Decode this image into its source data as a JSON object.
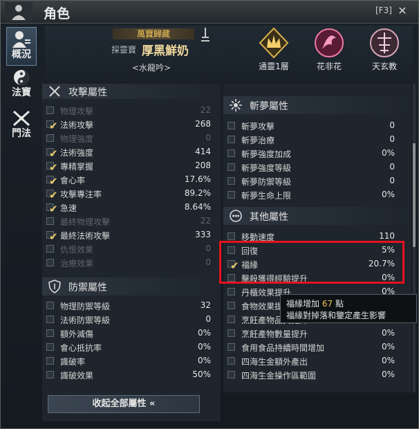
{
  "window": {
    "title": "角色",
    "hotkey": "[F3]"
  },
  "sidebar": [
    {
      "label": "概況",
      "icon": "character-overview-icon",
      "active": true
    },
    {
      "label": "法寶",
      "icon": "yin-yang-icon",
      "active": false
    },
    {
      "label": "門法",
      "icon": "sword-cross-icon",
      "active": false
    }
  ],
  "header": {
    "title_banner": "萬寶歸藏",
    "name_prefix": "探靈寶",
    "character_name": "厚黑鮮奶",
    "guild": "<水龍吟>",
    "badges": [
      {
        "label": "通靈1層",
        "icon": "crown-icon"
      },
      {
        "label": "花非花",
        "icon": "phoenix-icon"
      },
      {
        "label": "天玄教",
        "icon": "sect-emblem-icon"
      }
    ]
  },
  "attack_section": {
    "title": "攻擊屬性",
    "rows": [
      {
        "label": "物理攻擊",
        "value": "22",
        "checked": false,
        "dim": true
      },
      {
        "label": "法術攻擊",
        "value": "268",
        "checked": true,
        "dim": false
      },
      {
        "label": "物理強度",
        "value": "0",
        "checked": false,
        "dim": true
      },
      {
        "label": "法術強度",
        "value": "414",
        "checked": true,
        "dim": false
      },
      {
        "label": "專精掌握",
        "value": "208",
        "checked": true,
        "dim": false
      },
      {
        "label": "會心率",
        "value": "17.6%",
        "checked": true,
        "dim": false
      },
      {
        "label": "攻擊專注率",
        "value": "89.2%",
        "checked": true,
        "dim": false
      },
      {
        "label": "急速",
        "value": "8.64%",
        "checked": true,
        "dim": false
      },
      {
        "label": "最終物理攻擊",
        "value": "22",
        "checked": false,
        "dim": true
      },
      {
        "label": "最終法術攻擊",
        "value": "333",
        "checked": true,
        "dim": false
      },
      {
        "label": "仇恨效果",
        "value": "0",
        "checked": false,
        "dim": true
      },
      {
        "label": "治療效果",
        "value": "0",
        "checked": false,
        "dim": true
      }
    ]
  },
  "defense_section": {
    "title": "防禦屬性",
    "rows": [
      {
        "label": "物理防禦等級",
        "value": "32",
        "checked": false,
        "dim": false
      },
      {
        "label": "法術防禦等級",
        "value": "0",
        "checked": false,
        "dim": false
      },
      {
        "label": "額外減傷",
        "value": "0%",
        "checked": false,
        "dim": false
      },
      {
        "label": "會心抵抗率",
        "value": "0%",
        "checked": false,
        "dim": false
      },
      {
        "label": "識破率",
        "value": "0%",
        "checked": false,
        "dim": false
      },
      {
        "label": "識破效果",
        "value": "50%",
        "checked": false,
        "dim": false
      }
    ]
  },
  "dream_section": {
    "title": "斬夢屬性",
    "rows": [
      {
        "label": "斬夢攻擊",
        "value": "0",
        "checked": false,
        "dim": false
      },
      {
        "label": "斬夢治療",
        "value": "0",
        "checked": false,
        "dim": false
      },
      {
        "label": "斬夢強度加成",
        "value": "0%",
        "checked": false,
        "dim": false
      },
      {
        "label": "斬夢強度等級",
        "value": "0",
        "checked": false,
        "dim": false
      },
      {
        "label": "斬夢防禦等級",
        "value": "0",
        "checked": false,
        "dim": false
      },
      {
        "label": "斬夢生命上限",
        "value": "0%",
        "checked": false,
        "dim": false
      }
    ]
  },
  "other_section": {
    "title": "其他屬性",
    "rows": [
      {
        "label": "移動速度",
        "value": "110",
        "checked": false,
        "dim": false
      },
      {
        "label": "回復",
        "value": "5%",
        "checked": false,
        "dim": false
      },
      {
        "label": "福緣",
        "value": "20.7%",
        "checked": true,
        "dim": false
      },
      {
        "label": "擊殺獲得經驗提升",
        "value": "0%",
        "checked": false,
        "dim": false
      },
      {
        "label": "丹櫃效果提升",
        "value": "0%",
        "checked": false,
        "dim": false
      },
      {
        "label": "食物效果提升",
        "value": "0%",
        "checked": false,
        "dim": false
      },
      {
        "label": "烹飪產物品質提升",
        "value": "0%",
        "checked": false,
        "dim": false
      },
      {
        "label": "烹飪產物數量提升",
        "value": "0%",
        "checked": false,
        "dim": false
      },
      {
        "label": "食用食品持續時間增加",
        "value": "0%",
        "checked": false,
        "dim": false
      },
      {
        "label": "四海生金額外產出",
        "value": "0%",
        "checked": false,
        "dim": false
      },
      {
        "label": "四海生金操作區範圍",
        "value": "0%",
        "checked": false,
        "dim": false
      }
    ]
  },
  "collapse_button": "收起全部屬性 «",
  "tooltip": {
    "line1_prefix": "福緣增加",
    "line1_value": "67",
    "line1_suffix": "點",
    "line2": "福緣對掉落和鑒定產生影響"
  },
  "colors": {
    "highlight": "#e8121f",
    "accent_gold": "#f2c84f"
  }
}
